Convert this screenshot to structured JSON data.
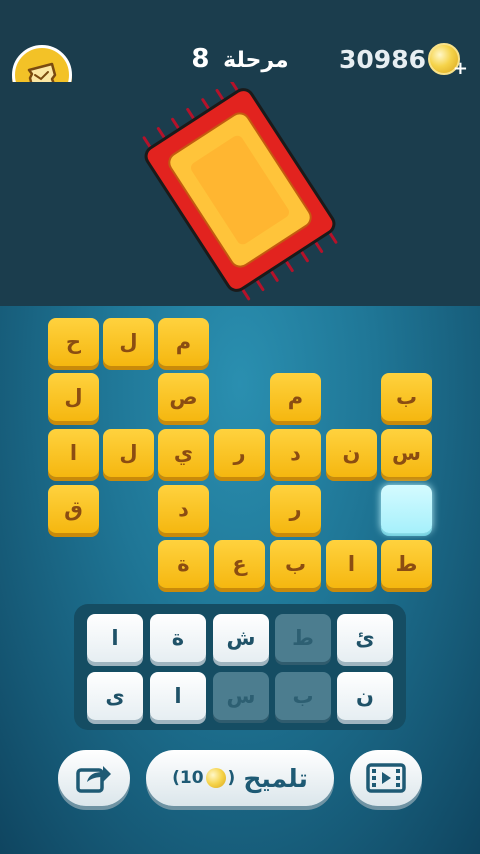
{
  "header": {
    "level_label": "مرحلة",
    "level_number": "8",
    "coins": "30986",
    "plus_symbol": "+"
  },
  "picture": {
    "subject": "red-carpet-rug"
  },
  "board": {
    "tiles": [
      "م",
      "ل",
      "ح",
      "ب",
      "م",
      "ص",
      "ل",
      "س",
      "ن",
      "د",
      "ر",
      "ي",
      "ل",
      "ا",
      "ر",
      "د",
      "ق",
      "ط",
      "ا",
      "ب",
      "ع",
      "ة"
    ],
    "empty_tile": ""
  },
  "keypad": {
    "keys": [
      "ئ",
      "ط",
      "ش",
      "ة",
      "ا",
      "ن",
      "ب",
      "س",
      "ا",
      "ى"
    ]
  },
  "actions": {
    "hint_label": "تلميح",
    "hint_cost": "10",
    "open_paren": "(",
    "close_paren": ")"
  },
  "colors": {
    "tile": "#f5b710",
    "tile_text": "#8b4d12",
    "empty_tile": "#a6f0fb",
    "key": "#ffffff",
    "key_used": "#4c7d8f"
  }
}
